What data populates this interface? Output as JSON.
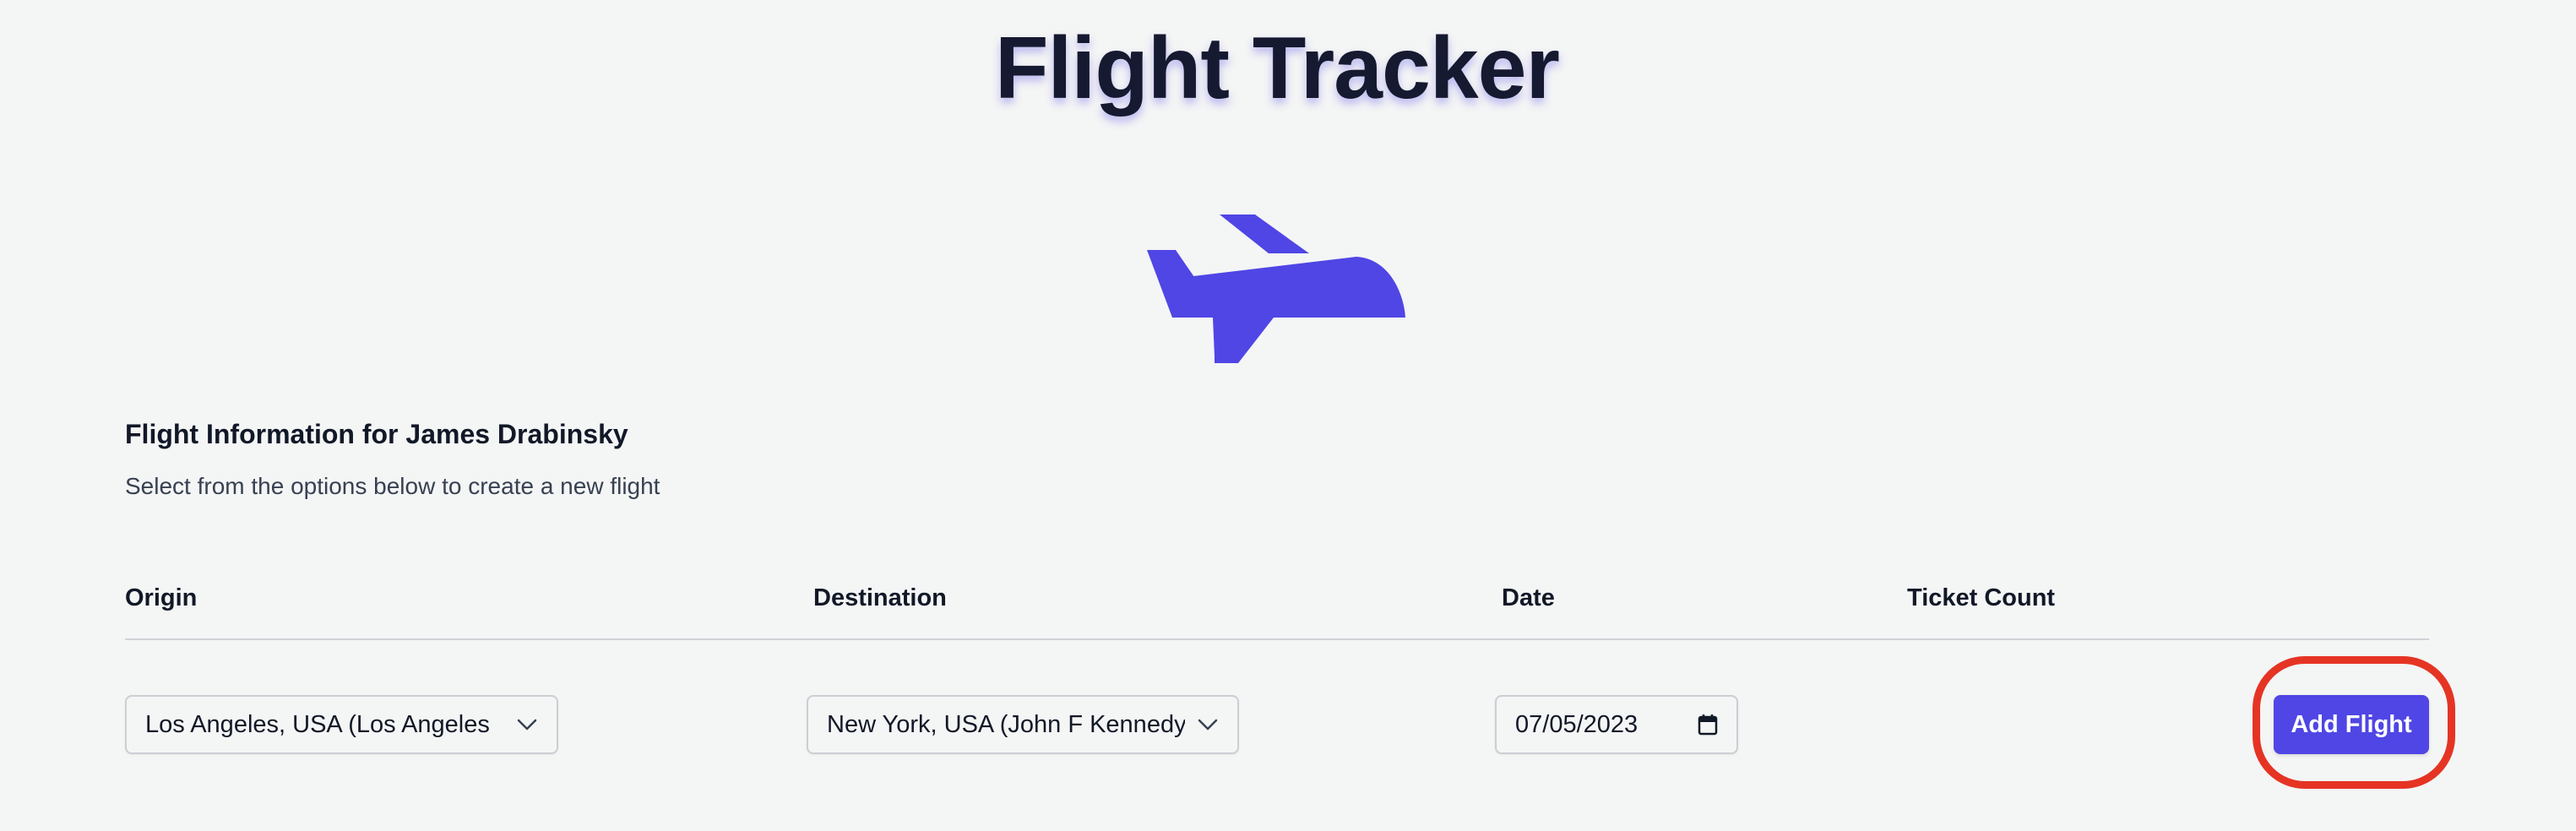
{
  "header": {
    "title": "Flight Tracker"
  },
  "hero": {
    "icon": "airplane-icon",
    "color": "#4f46e5"
  },
  "info": {
    "heading": "Flight Information for James Drabinsky",
    "subheading": "Select from the options below to create a new flight"
  },
  "table": {
    "headers": {
      "origin": "Origin",
      "destination": "Destination",
      "date": "Date",
      "ticket_count": "Ticket Count"
    }
  },
  "form": {
    "origin_value": "Los Angeles, USA (Los Angeles",
    "destination_value": "New York, USA (John F Kennedy",
    "date_value": "07/05/2023",
    "add_button_label": "Add Flight"
  },
  "colors": {
    "accent": "#4f46e5",
    "highlight": "#e53424",
    "background": "#f4f5f5"
  }
}
